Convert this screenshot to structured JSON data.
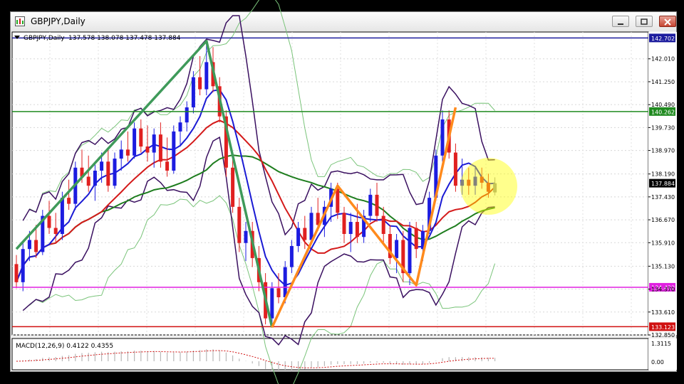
{
  "window": {
    "title": "GBPJPY,Daily",
    "buttons": [
      "minimize",
      "restore",
      "close"
    ]
  },
  "chart_data": {
    "type": "candlestick",
    "symbol_header": "GBPJPY,Daily",
    "ohlc_header": "137.578 138.078 137.478 137.884",
    "price_axis_ticks": [
      "142.010",
      "141.250",
      "140.490",
      "139.730",
      "138.970",
      "138.190",
      "137.430",
      "136.670",
      "135.910",
      "135.130",
      "134.370",
      "133.610",
      "132.850"
    ],
    "ylim": [
      132.85,
      142.9
    ],
    "horizontal_levels": [
      {
        "label": "142.702",
        "value": 142.702,
        "color": "#1c1c9e"
      },
      {
        "label": "140.262",
        "value": 140.262,
        "color": "#1f8a1f"
      },
      {
        "label": "134.432",
        "value": 134.432,
        "color": "#e020e0"
      },
      {
        "label": "133.123",
        "value": 133.123,
        "color": "#d01010"
      }
    ],
    "current_price": {
      "label": "137.884",
      "value": 137.884
    },
    "candles": [
      [
        135.2,
        135.5,
        134.4,
        134.6
      ],
      [
        134.6,
        135.9,
        134.3,
        135.7
      ],
      [
        135.7,
        136.3,
        135.3,
        136.0
      ],
      [
        136.0,
        136.5,
        135.4,
        135.6
      ],
      [
        135.6,
        137.0,
        135.5,
        136.8
      ],
      [
        136.8,
        137.3,
        136.2,
        136.4
      ],
      [
        136.4,
        136.9,
        135.9,
        136.2
      ],
      [
        136.2,
        137.6,
        136.0,
        137.4
      ],
      [
        137.4,
        138.0,
        137.0,
        137.2
      ],
      [
        137.2,
        138.6,
        137.0,
        138.4
      ],
      [
        138.4,
        139.0,
        137.9,
        138.1
      ],
      [
        138.1,
        138.8,
        137.6,
        137.8
      ],
      [
        137.8,
        138.5,
        137.3,
        138.3
      ],
      [
        138.3,
        138.9,
        137.9,
        138.6
      ],
      [
        138.6,
        139.0,
        137.6,
        137.8
      ],
      [
        137.8,
        138.9,
        137.7,
        138.7
      ],
      [
        138.7,
        139.3,
        138.3,
        139.0
      ],
      [
        139.0,
        139.6,
        138.6,
        138.8
      ],
      [
        138.8,
        139.9,
        138.7,
        139.7
      ],
      [
        139.7,
        140.0,
        138.9,
        139.1
      ],
      [
        139.1,
        139.8,
        138.6,
        138.9
      ],
      [
        138.9,
        139.7,
        138.4,
        139.5
      ],
      [
        139.5,
        139.9,
        138.4,
        138.6
      ],
      [
        138.6,
        139.4,
        138.1,
        138.3
      ],
      [
        138.3,
        139.8,
        138.2,
        139.6
      ],
      [
        139.6,
        140.1,
        139.1,
        139.9
      ],
      [
        139.9,
        140.6,
        139.6,
        140.4
      ],
      [
        140.4,
        141.6,
        140.2,
        141.4
      ],
      [
        141.4,
        142.1,
        140.8,
        141.0
      ],
      [
        141.0,
        142.6,
        140.8,
        141.9
      ],
      [
        141.9,
        142.4,
        140.9,
        141.1
      ],
      [
        141.1,
        141.4,
        139.9,
        140.1
      ],
      [
        140.1,
        140.3,
        138.1,
        138.4
      ],
      [
        138.4,
        138.7,
        136.9,
        137.1
      ],
      [
        137.1,
        137.4,
        135.6,
        135.9
      ],
      [
        135.9,
        136.6,
        135.3,
        136.3
      ],
      [
        136.3,
        136.6,
        135.1,
        135.4
      ],
      [
        135.4,
        135.8,
        134.3,
        134.6
      ],
      [
        134.6,
        134.9,
        133.2,
        133.4
      ],
      [
        133.4,
        134.6,
        133.1,
        134.4
      ],
      [
        134.4,
        134.9,
        133.9,
        134.1
      ],
      [
        134.1,
        135.3,
        133.9,
        135.1
      ],
      [
        135.1,
        136.0,
        134.9,
        135.8
      ],
      [
        135.8,
        136.6,
        135.6,
        136.4
      ],
      [
        136.4,
        136.8,
        135.7,
        136.0
      ],
      [
        136.0,
        137.1,
        135.9,
        136.9
      ],
      [
        136.9,
        137.4,
        136.3,
        136.5
      ],
      [
        136.5,
        137.3,
        136.1,
        137.1
      ],
      [
        137.1,
        137.9,
        136.6,
        137.7
      ],
      [
        137.7,
        137.9,
        136.7,
        136.9
      ],
      [
        136.9,
        137.1,
        135.9,
        136.2
      ],
      [
        136.2,
        136.9,
        135.6,
        136.6
      ],
      [
        136.6,
        137.2,
        135.9,
        136.1
      ],
      [
        136.1,
        137.0,
        135.9,
        136.8
      ],
      [
        136.8,
        137.7,
        136.6,
        137.5
      ],
      [
        137.5,
        137.9,
        136.6,
        136.8
      ],
      [
        136.8,
        137.1,
        135.9,
        136.2
      ],
      [
        136.2,
        136.5,
        135.2,
        135.4
      ],
      [
        135.4,
        136.2,
        134.9,
        136.0
      ],
      [
        136.0,
        136.3,
        134.6,
        134.9
      ],
      [
        134.9,
        136.6,
        134.5,
        136.4
      ],
      [
        136.4,
        136.6,
        135.4,
        135.7
      ],
      [
        135.7,
        136.5,
        135.3,
        136.3
      ],
      [
        136.3,
        137.6,
        136.2,
        137.4
      ],
      [
        137.4,
        139.0,
        137.3,
        138.8
      ],
      [
        138.8,
        140.3,
        138.6,
        140.0
      ],
      [
        140.0,
        140.3,
        138.7,
        138.9
      ],
      [
        138.9,
        139.2,
        137.6,
        137.8
      ],
      [
        137.8,
        138.7,
        137.5,
        138.0
      ],
      [
        138.0,
        138.4,
        137.5,
        137.8
      ],
      [
        137.8,
        138.4,
        137.5,
        138.1
      ],
      [
        138.1,
        138.4,
        137.7,
        137.9
      ],
      [
        137.9,
        138.2,
        137.4,
        137.6
      ],
      [
        137.578,
        138.078,
        137.478,
        137.884
      ]
    ],
    "zigzag_green": [
      [
        0,
        135.7
      ],
      [
        29,
        142.6
      ],
      [
        39,
        133.1
      ]
    ],
    "zigzag_orange": [
      [
        39,
        133.1
      ],
      [
        49,
        137.8
      ],
      [
        61,
        134.5
      ],
      [
        67,
        140.4
      ]
    ],
    "macd_header": "MACD(12,26,9) 0.4122 0.4355",
    "macd_axis_ticks": [
      "1.3115",
      "0.00"
    ]
  }
}
